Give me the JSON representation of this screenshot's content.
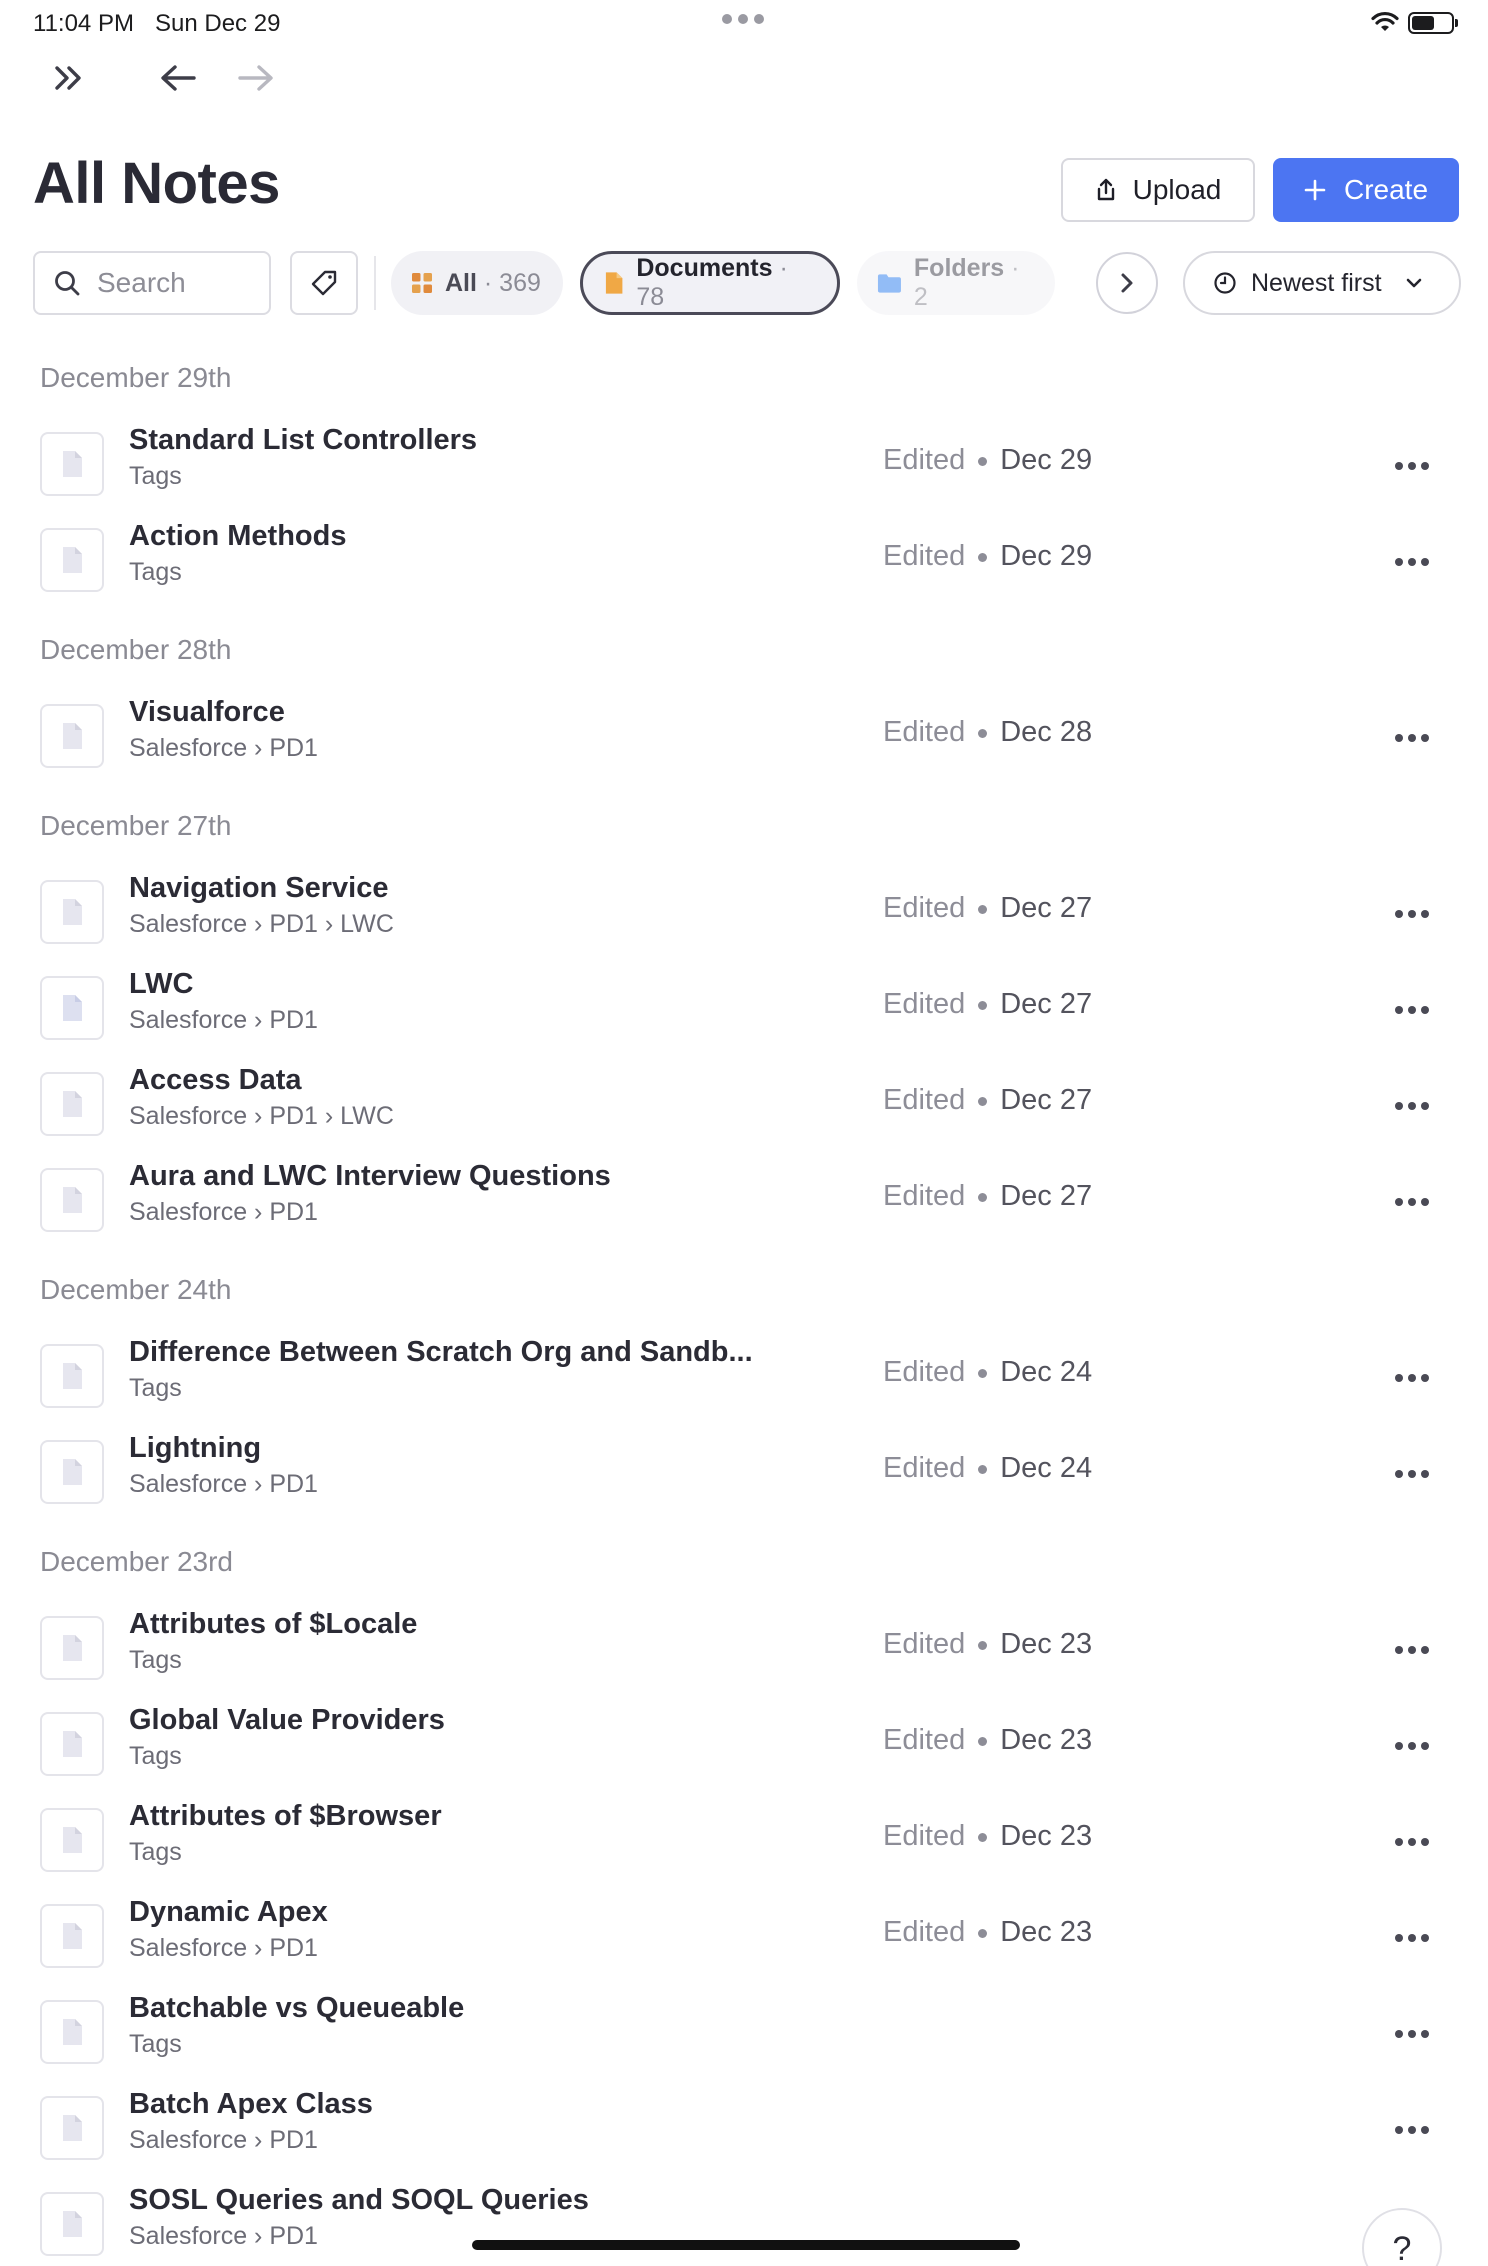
{
  "status": {
    "time": "11:04 PM",
    "date": "Sun Dec 29"
  },
  "header": {
    "title": "All Notes",
    "upload_label": "Upload",
    "create_label": "Create"
  },
  "filters": {
    "search_placeholder": "Search",
    "chips": [
      {
        "label": "All",
        "count": "· 369"
      },
      {
        "label": "Documents",
        "count": "· 78"
      },
      {
        "label": "Folders",
        "count": "· 2"
      }
    ],
    "sort_label": "Newest first"
  },
  "edited_label": "Edited",
  "sections": [
    {
      "header": "December 29th",
      "items": [
        {
          "title": "Standard List Controllers",
          "sub": "Tags",
          "date": "Dec 29"
        },
        {
          "title": "Action Methods",
          "sub": "Tags",
          "date": "Dec 29"
        }
      ]
    },
    {
      "header": "December 28th",
      "items": [
        {
          "title": "Visualforce",
          "sub": "Salesforce › PD1",
          "date": "Dec 28"
        }
      ]
    },
    {
      "header": "December 27th",
      "items": [
        {
          "title": "Navigation Service",
          "sub": "Salesforce › PD1 › LWC",
          "date": "Dec 27"
        },
        {
          "title": "LWC",
          "sub": "Salesforce › PD1",
          "date": "Dec 27"
        },
        {
          "title": "Access Data",
          "sub": "Salesforce › PD1 › LWC",
          "date": "Dec 27"
        },
        {
          "title": "Aura and LWC Interview Questions",
          "sub": "Salesforce › PD1",
          "date": "Dec 27"
        }
      ]
    },
    {
      "header": "December 24th",
      "items": [
        {
          "title": "Difference Between Scratch Org and Sandb...",
          "sub": "Tags",
          "date": "Dec 24"
        },
        {
          "title": "Lightning",
          "sub": "Salesforce › PD1",
          "date": "Dec 24"
        }
      ]
    },
    {
      "header": "December 23rd",
      "items": [
        {
          "title": "Attributes of $Locale",
          "sub": "Tags",
          "date": "Dec 23"
        },
        {
          "title": "Global Value Providers",
          "sub": "Tags",
          "date": "Dec 23"
        },
        {
          "title": "Attributes of $Browser",
          "sub": "Tags",
          "date": "Dec 23"
        },
        {
          "title": "Dynamic Apex",
          "sub": "Salesforce › PD1",
          "date": "Dec 23"
        },
        {
          "title": "Batchable vs Queueable",
          "sub": "Tags",
          "date": ""
        },
        {
          "title": "Batch Apex Class",
          "sub": "Salesforce › PD1",
          "date": ""
        },
        {
          "title": "SOSL Queries and SOQL Queries",
          "sub": "Salesforce › PD1",
          "date": ""
        }
      ]
    }
  ],
  "help_label": "?",
  "colors": {
    "accent": "#4c75f2",
    "documents_icon": "#f0a845",
    "folders_icon": "#3a86f0",
    "all_icon": "#e08a3c"
  }
}
